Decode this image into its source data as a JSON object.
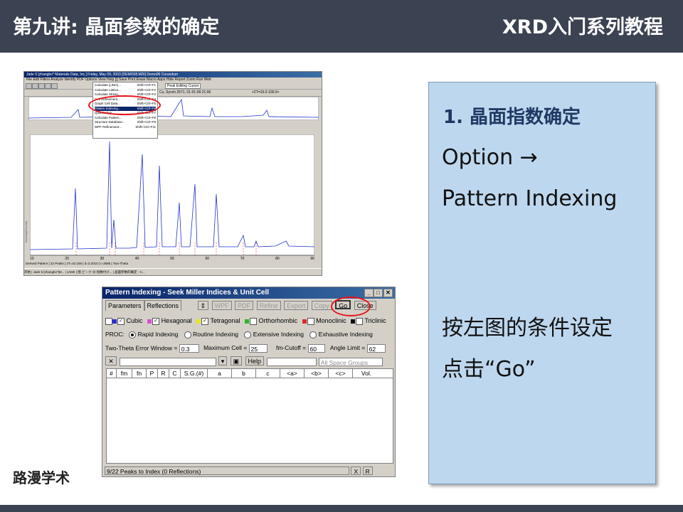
{
  "header": {
    "lecture_title": "第九讲: 晶面参数的确定",
    "series_title": "XRD入门系列教程"
  },
  "brand": "路漫学术",
  "jade": {
    "title_bar": "Jade 6 [zhangbo* Materials Data, Inc.] Friday, May 09, 2003 [DEMO08.MDI] Demo06 Corundum",
    "menu_bar": "File  Edit  Filters  Analyze  Identify  PDF  Options  View  Help  [|]  Save  Print  Erase  Macro  Apps  Hide  Report  Zoom  Run  Web",
    "options_menu": [
      {
        "label": "Calculate (j.ING)...",
        "shortcut": "Shift+Ctrl+F1"
      },
      {
        "label": "Calculate Lattice...",
        "shortcut": "Shift+Ctrl+F2"
      },
      {
        "label": "Calculate Stress...",
        "shortcut": "Shift+Ctrl+F3"
      },
      {
        "label": "Cell Refinement...",
        "shortcut": "Shift+Ctrl+F4"
      },
      {
        "label": "Graph Cell Data...",
        "shortcut": "Shift+Ctrl+F5"
      },
      {
        "label": "Pattern Indexing...",
        "shortcut": "Shift+Ctrl+F6"
      },
      {
        "label": "Quantitative...",
        "shortcut": "Shift+Ctrl+F7"
      },
      {
        "label": "Calculate Pattern...",
        "shortcut": "Shift+Ctrl+F8"
      },
      {
        "label": "Structure Database...",
        "shortcut": "Shift+Ctrl+F9"
      },
      {
        "label": "WPF Refinement...",
        "shortcut": "Shift+Ctrl+F11"
      }
    ],
    "peak_cursor": "Peak Editing Cursor",
    "ref_info": "Cu, Synch.2571, 01-01-99 21:00",
    "range_info": "<2T=10.0-100.0>",
    "status": "Derived Pattern | 22 Peaks | 2T=42.156 | d=3.2010 | I=3585 | Two-Theta",
    "axis_x_ticks": [
      "10",
      "20",
      "30",
      "40",
      "50",
      "60",
      "70",
      "80",
      "90"
    ],
    "ylabel": "Intensity(Counts)",
    "taskbar": "开始 | Jade 6 [zhangbo*|M... | JADE | 图 ピーク·分 指数付け... | 晶面参数的确定 - C..."
  },
  "dialog": {
    "title": "Pattern Indexing - Seek Miller Indices & Unit Cell",
    "tabs": [
      "Parameters",
      "Reflections"
    ],
    "buttons": {
      "wpf": "WPF",
      "pdf": "PDF",
      "refine": "Refine",
      "export": "Export",
      "copy": "Copy",
      "go": "Go",
      "close": "Close"
    },
    "systems": [
      {
        "label": "Cubic",
        "checked": true,
        "color": "#2b2bd9"
      },
      {
        "label": "Hexagonal",
        "checked": true,
        "color": "#d94ed9"
      },
      {
        "label": "Tetragonal",
        "checked": false,
        "color": "#e8e81a"
      },
      {
        "label": "Orthorhombic",
        "checked": false,
        "color": "#2bb52b"
      },
      {
        "label": "Monoclinic",
        "checked": false,
        "color": "#d92b2b"
      },
      {
        "label": "Triclinic",
        "checked": false,
        "color": "#111111"
      }
    ],
    "proc_label": "PROC:",
    "proc_options": [
      {
        "label": "Rapid Indexing",
        "selected": true
      },
      {
        "label": "Routine Indexing",
        "selected": false
      },
      {
        "label": "Extensive Indexing",
        "selected": false
      },
      {
        "label": "Exhaustive Indexing",
        "selected": false
      }
    ],
    "fields": {
      "two_theta_label": "Two-Theta Error Window =",
      "two_theta_value": "0.3",
      "max_cell_label": "Maximum Cell =",
      "max_cell_value": "25",
      "fm_cutoff_label": "fm-Cutoff =",
      "fm_cutoff_value": "60",
      "angle_limit_label": "Angle Limit =",
      "angle_limit_value": "62"
    },
    "help": "Help",
    "space_groups": "All Space Groups",
    "columns": [
      "#",
      "fm",
      "fn",
      "P",
      "R",
      "C",
      "S.G.(#)",
      "a",
      "b",
      "c",
      "<a>",
      "<b>",
      "<c>",
      "Vol."
    ],
    "status_text": "9/22 Peaks to Index (0 Reflections)",
    "status_right": [
      "X",
      "R"
    ]
  },
  "panel": {
    "heading": "1. 晶面指数确定",
    "line1": "Option →",
    "line2": "Pattern Indexing",
    "line3": "按左图的条件设定",
    "line4": "点击“Go”"
  },
  "accent_colors": {
    "header_bg": "#3b4352",
    "panel_bg": "#bdd7ee",
    "highlight_red": "#e8141a",
    "pattern_blue": "#2233cc"
  }
}
